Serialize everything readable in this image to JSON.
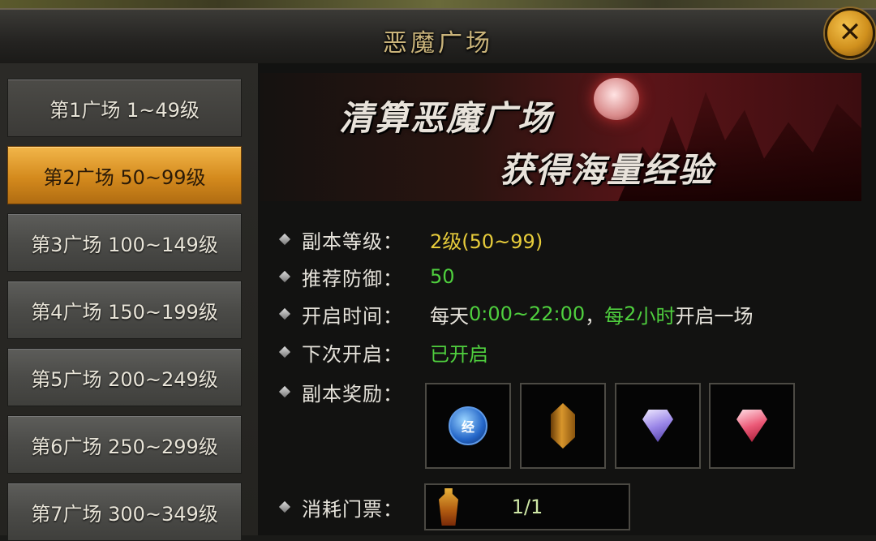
{
  "window": {
    "title": "恶魔广场"
  },
  "levels": [
    {
      "label": "第1广场 1~49级"
    },
    {
      "label": "第2广场 50~99级",
      "active": true
    },
    {
      "label": "第3广场 100~149级"
    },
    {
      "label": "第4广场 150~199级"
    },
    {
      "label": "第5广场 200~249级"
    },
    {
      "label": "第6广场 250~299级"
    },
    {
      "label": "第7广场 300~349级"
    }
  ],
  "banner": {
    "line1": "清算恶魔广场",
    "line2": "获得海量经验"
  },
  "info": {
    "level": {
      "label": "副本等级：",
      "value": "2级(50~99)"
    },
    "defense": {
      "label": "推荐防御：",
      "value": "50"
    },
    "open_time": {
      "label": "开启时间：",
      "p1": "每天",
      "p2": "0:00~22:00",
      "p3": "，",
      "p4": "每",
      "p5": "2",
      "p6": "小时",
      "p7": "开启一场"
    },
    "next_open": {
      "label": "下次开启：",
      "value": "已开启"
    },
    "rewards": {
      "label": "副本奖励：",
      "items": [
        {
          "icon": "exp-orb-icon",
          "glyph": "经"
        },
        {
          "icon": "amber-crystal-icon"
        },
        {
          "icon": "purple-gem-icon"
        },
        {
          "icon": "red-gem-icon"
        }
      ]
    },
    "ticket": {
      "label": "消耗门票：",
      "count": "1/1",
      "icon": "ticket-icon"
    }
  },
  "colors": {
    "accent_gold": "#d48a1d",
    "value_yellow": "#e7cc3b",
    "value_green": "#4fcf3e"
  }
}
